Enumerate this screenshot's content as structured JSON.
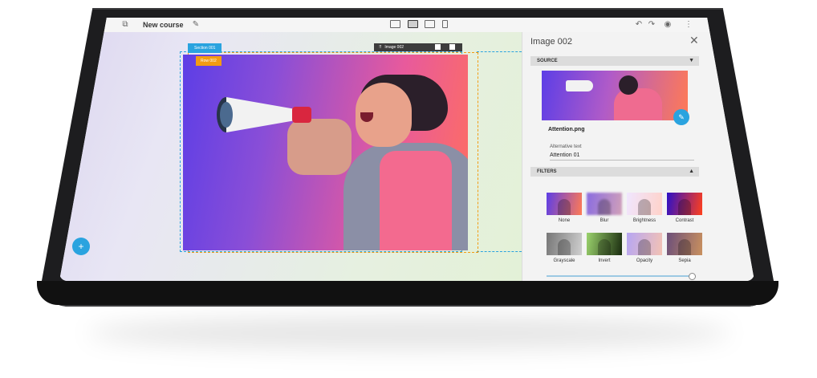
{
  "header": {
    "course_title": "New course",
    "icons": [
      "layers-icon",
      "pencil-icon",
      "desktop-icon",
      "laptop-icon",
      "tablet-icon",
      "phone-icon",
      "undo-icon",
      "redo-icon",
      "eye-icon",
      "more-icon"
    ]
  },
  "canvas": {
    "section_tag": "Section 001",
    "row_tag": "Row 002",
    "image_tag": "Image 002",
    "add_button": "+"
  },
  "panel": {
    "title": "Image 002",
    "source_label": "SOURCE",
    "file_name": "Attention.png",
    "alt_text_label": "Alternative text",
    "alt_text_value": "Attention 01",
    "filters_label": "FILTERS",
    "filters": [
      "None",
      "Blur",
      "Brightness",
      "Contrast",
      "Grayscale",
      "Invert",
      "Opacity",
      "Sepia"
    ]
  },
  "colors": {
    "accent": "#2aa3df",
    "row_tag": "#f39c12"
  }
}
